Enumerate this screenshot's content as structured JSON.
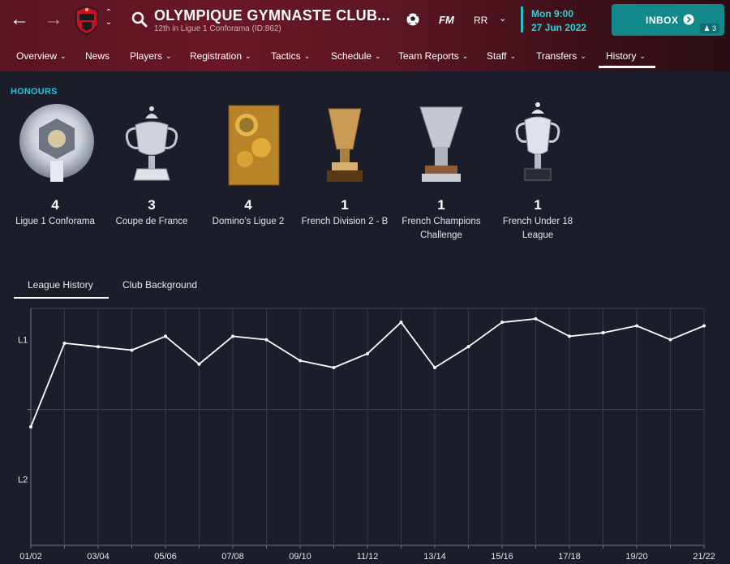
{
  "header": {
    "club_name": "OLYMPIQUE GYMNASTE CLUB...",
    "club_subtitle": "12th in Ligue 1 Conforama (ID:862)",
    "fm_logo": "FM",
    "manager_initials": "RR",
    "time": "Mon 9:00",
    "date": "27 Jun 2022",
    "inbox_label": "INBOX",
    "inbox_count": "3",
    "icons": [
      "back-arrow-icon",
      "forward-arrow-icon",
      "club-crest-icon",
      "search-icon",
      "ball-icon",
      "chevron-down-icon",
      "arrow-circle-icon",
      "person-icon"
    ]
  },
  "menu": {
    "items": [
      {
        "label": "Overview",
        "has_dropdown": true
      },
      {
        "label": "News",
        "has_dropdown": false
      },
      {
        "label": "Players",
        "has_dropdown": true
      },
      {
        "label": "Registration",
        "has_dropdown": true
      },
      {
        "label": "Tactics",
        "has_dropdown": true
      },
      {
        "label": "Schedule",
        "has_dropdown": true
      },
      {
        "label": "Team Reports",
        "has_dropdown": true
      },
      {
        "label": "Staff",
        "has_dropdown": true
      },
      {
        "label": "Transfers",
        "has_dropdown": true
      },
      {
        "label": "History",
        "has_dropdown": true
      }
    ],
    "active": "History"
  },
  "honours": {
    "title": "HONOURS",
    "items": [
      {
        "count": "4",
        "name": "Ligue 1 Conforama"
      },
      {
        "count": "3",
        "name": "Coupe de France"
      },
      {
        "count": "4",
        "name": "Domino’s Ligue 2"
      },
      {
        "count": "1",
        "name": "French Division 2 - B"
      },
      {
        "count": "1",
        "name": "French Champions Challenge"
      },
      {
        "count": "1",
        "name": "French Under 18 League"
      }
    ]
  },
  "tabs": [
    {
      "label": "League History",
      "active": true
    },
    {
      "label": "Club Background",
      "active": false
    }
  ],
  "colors": {
    "accent_cyan": "#1fc6e0",
    "inbox_teal": "#12888b",
    "header_red": "#6a1726",
    "background": "#1b1d2a"
  },
  "chart_data": {
    "type": "line",
    "title": "",
    "y_tick_labels": [
      "L1",
      "L2"
    ],
    "x_tick_labels": [
      "01/02",
      "03/04",
      "05/06",
      "07/08",
      "09/10",
      "11/12",
      "13/14",
      "15/16",
      "17/18",
      "19/20",
      "21/22"
    ],
    "x": [
      "01/02",
      "02/03",
      "03/04",
      "04/05",
      "05/06",
      "06/07",
      "07/08",
      "08/09",
      "09/10",
      "10/11",
      "11/12",
      "12/13",
      "13/14",
      "14/15",
      "15/16",
      "16/17",
      "17/18",
      "18/19",
      "19/20",
      "20/21",
      "21/22"
    ],
    "series": [
      {
        "values": [
          23,
          11,
          11.5,
          12,
          10,
          14,
          10,
          10.5,
          13.5,
          14.5,
          12.5,
          8,
          14.5,
          11.5,
          8,
          7.5,
          10,
          9.5,
          8.5,
          10.5,
          8.5
        ],
        "unit": "overall position (1-20 = L1, 21-40 = L2)"
      }
    ],
    "ylim": [
      40,
      6
    ],
    "grid": true
  }
}
